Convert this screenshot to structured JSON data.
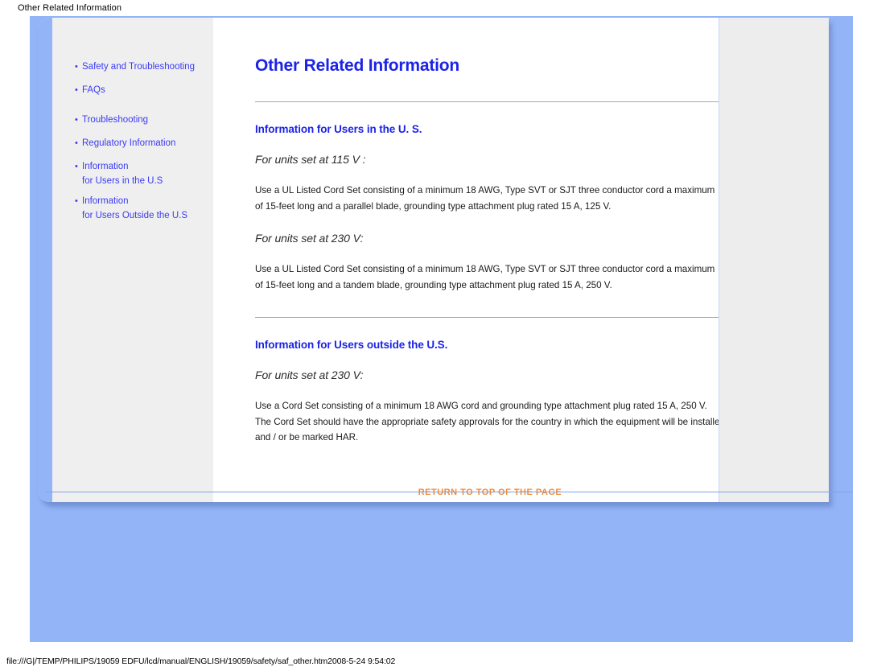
{
  "window": {
    "caption": "Other Related Information"
  },
  "sidebar": {
    "bullet": "•",
    "items": [
      {
        "label": "Safety and Troubleshooting",
        "subline": null
      },
      {
        "label": "FAQs",
        "subline": null
      },
      {
        "label": "Troubleshooting",
        "subline": null
      },
      {
        "label": "Regulatory Information",
        "subline": null
      },
      {
        "label": "Information",
        "subline": "for Users in the U.S"
      },
      {
        "label": "Information",
        "subline": "for Users Outside the U.S"
      }
    ]
  },
  "main": {
    "title": "Other Related Information",
    "sections": [
      {
        "heading": "Information for Users in the U. S.",
        "blocks": [
          {
            "subheading": "For units set at 115 V :",
            "paragraph": "Use a UL Listed Cord Set consisting of a minimum 18 AWG, Type SVT or SJT three conductor cord a maximum of 15-feet long and a parallel blade, grounding type attachment plug rated 15 A, 125 V."
          },
          {
            "subheading": "For units set at 230 V:",
            "paragraph": "Use a UL Listed Cord Set consisting of a minimum 18 AWG, Type SVT or SJT three conductor cord a maximum of 15-feet long and a tandem blade, grounding type attachment plug rated 15 A, 250 V."
          }
        ]
      },
      {
        "heading": "Information for Users outside the U.S.",
        "blocks": [
          {
            "subheading": "For units set at 230 V:",
            "paragraph": "Use a Cord Set consisting of a minimum 18 AWG cord and grounding type attachment plug rated 15 A, 250 V. The Cord Set should have the appropriate safety approvals for the country in which the equipment will be installed and / or be marked HAR."
          }
        ]
      }
    ],
    "return_link": "RETURN TO TOP OF THE PAGE"
  },
  "footer": {
    "path": "file:///G|/TEMP/PHILIPS/19059 EDFU/lcd/manual/ENGLISH/19059/safety/saf_other.htm2008-5-24 9:54:02"
  },
  "colors": {
    "blue_field": "#93b4f7",
    "heading_blue": "#1c23e8",
    "link_blue": "#3b3bf5",
    "return_orange": "#f58a33",
    "sidebar_grey": "#efefef"
  }
}
